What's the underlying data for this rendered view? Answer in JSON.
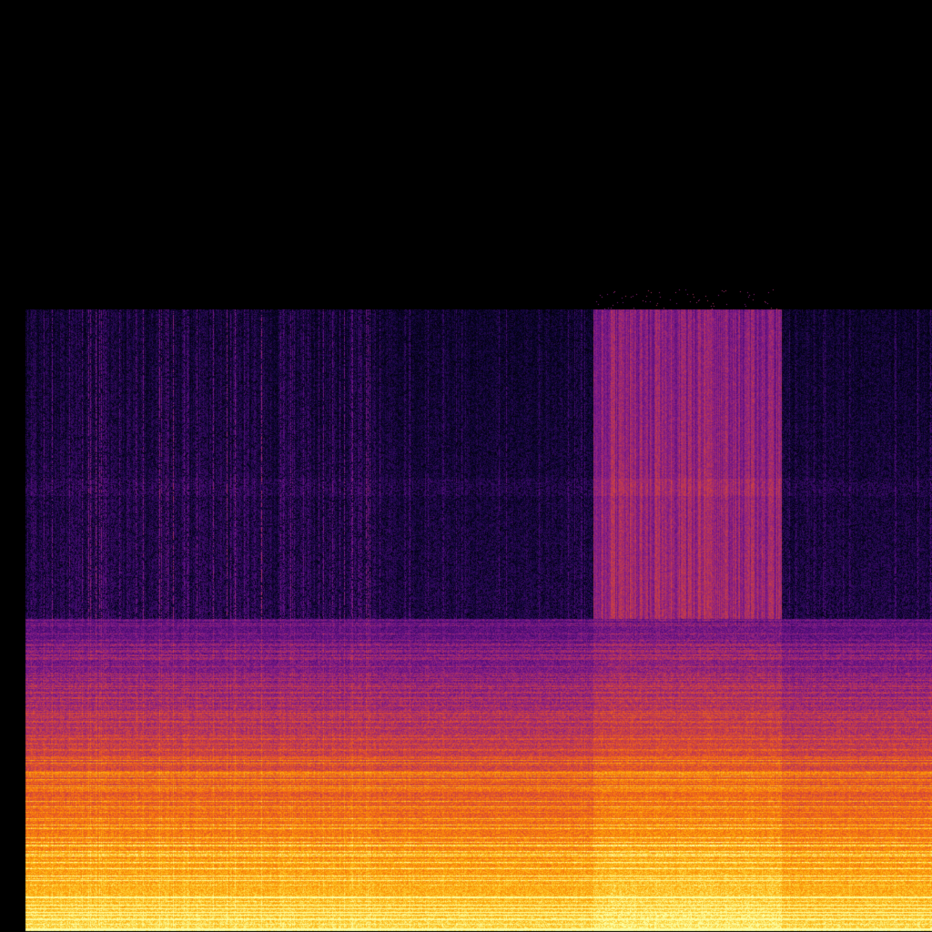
{
  "image": {
    "kind": "spectrogram",
    "colormap": "inferno",
    "background": "#000000",
    "palette": [
      "#000000",
      "#0b0531",
      "#320a5e",
      "#5b0f80",
      "#8a2084",
      "#bb3754",
      "#e0502c",
      "#f6760f",
      "#fca50a",
      "#fcd13b",
      "#fcffa4"
    ]
  }
}
